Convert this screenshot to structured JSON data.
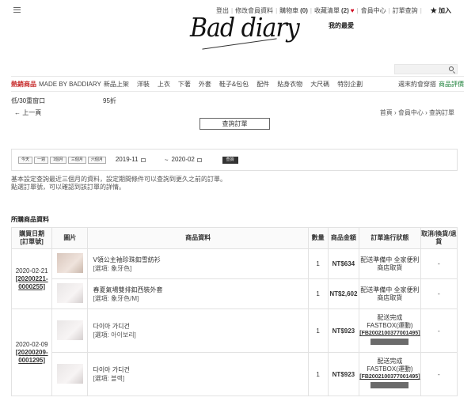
{
  "topnav": {
    "logout": "登出",
    "edit_profile": "修改會員資料",
    "cart_label": "購物車",
    "cart_count": "(0)",
    "wishlist_label": "收藏清單",
    "wishlist_count": "(2)",
    "member_center": "會員中心",
    "order_query": "訂單查詢",
    "join": "加入"
  },
  "logo": "Bad diary",
  "my_wishlist": "我的最愛",
  "catnav": {
    "hot": "熱銷商品",
    "items": [
      "MADE BY BADDIARY",
      "新品上架",
      "洋裝",
      "上衣",
      "下著",
      "外套",
      "鞋子&包包",
      "配件",
      "貼身衣物",
      "大尺碼",
      "特別企劃"
    ],
    "week_ship": "週末約會穿搭",
    "review": "商品評價"
  },
  "member": {
    "level": "低/30重窗口",
    "discount": "95折"
  },
  "back_link": "← 上一頁",
  "breadcrumb": "首頁 › 會員中心 › 查詢訂單",
  "query_button": "查詢訂單",
  "filter": {
    "quick": [
      "今天",
      "一週",
      "1個月",
      "三個月",
      "六個月"
    ],
    "date_from": "2019-11",
    "date_to": "2020-02",
    "search_button": "查詢"
  },
  "notes": [
    "基本設定查詢最近三個月的資料，設定期間條件可以查詢到更久之前的訂單。",
    "點選訂單號，可以確認到該訂單的詳情。"
  ],
  "section_title": "所購商品資料",
  "table": {
    "headers": {
      "date": "購買日期\n[訂單號]",
      "image": "圖片",
      "info": "商品資料",
      "qty": "數量",
      "amount": "商品金額",
      "status": "訂單進行狀態",
      "return": "取消/換貨/退貨"
    },
    "orders": [
      {
        "date": "2020-02-21",
        "number": "[20200221-0000255]",
        "items": [
          {
            "name": "V領公主袖珍珠釦雪紡衫",
            "option": "[選項: 象牙色]",
            "qty": "1",
            "amount": "NT$634",
            "status": "配送準備中 全家便利商店取貨",
            "return": "-"
          },
          {
            "name": "春夏氣場雙排釦西裝外套",
            "option": "[選項: 象牙色/M]",
            "qty": "1",
            "amount": "NT$2,602",
            "status": "配送準備中 全家便利商店取貨",
            "return": "-"
          }
        ]
      },
      {
        "date": "2020-02-09",
        "number": "[20200209-0001295]",
        "items": [
          {
            "name": "다이아 가디건",
            "option": "[選項: 아이보리]",
            "qty": "1",
            "amount": "NT$923",
            "status": "配送完成 FASTBOX(運動)",
            "tracking": "[FB2002100377001495]",
            "return": "-"
          },
          {
            "name": "다이아 가디건",
            "option": "[選項: 블랙]",
            "qty": "1",
            "amount": "NT$923",
            "status": "配送完成 FASTBOX(運動)",
            "tracking": "[FB2002100377001495]",
            "return": "-"
          }
        ]
      }
    ]
  }
}
